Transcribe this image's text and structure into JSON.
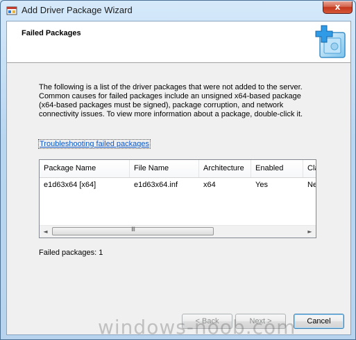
{
  "window": {
    "title": "Add Driver Package Wizard",
    "close_glyph": "x"
  },
  "header": {
    "title": "Failed Packages",
    "icon": "driver-package-add-icon"
  },
  "body": {
    "description": "The following is a list of the driver packages that were not added to the server. Common causes for failed packages include an unsigned x64-based package (x64-based packages must be signed), package corruption, and network connectivity issues. To view more information about a package, double-click it.",
    "link": "Troubleshooting failed packages"
  },
  "table": {
    "columns": [
      "Package Name",
      "File Name",
      "Architecture",
      "Enabled",
      "Cla"
    ],
    "rows": [
      [
        "e1d63x64 [x64]",
        "e1d63x64.inf",
        "x64",
        "Yes",
        "Ne"
      ]
    ],
    "scroll_left_glyph": "◄",
    "scroll_right_glyph": "►",
    "grip_glyph": "III"
  },
  "status": {
    "failed_count_text": "Failed packages: 1"
  },
  "buttons": {
    "back": "< Back",
    "next": "Next >",
    "cancel": "Cancel"
  },
  "watermark": "windows-noob.com",
  "colors": {
    "link": "#0b55c4",
    "close_button": "#c4371c"
  }
}
